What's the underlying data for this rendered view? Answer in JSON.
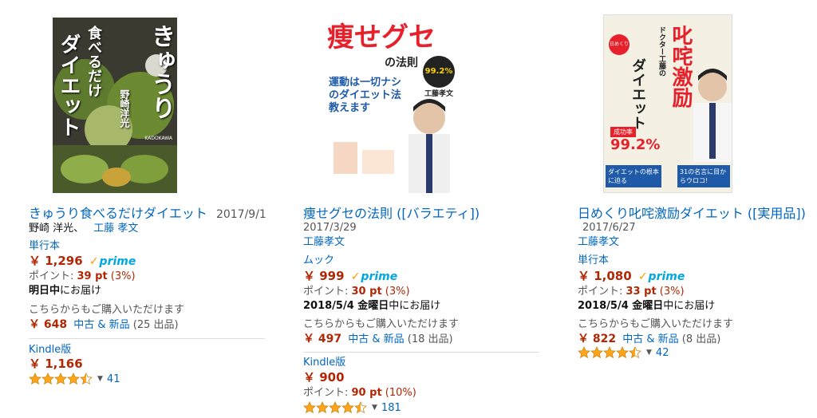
{
  "products": [
    {
      "cover": {
        "title_big": "きゅうり",
        "title_sub": "食べるだけ",
        "title_main": "ダイエット",
        "authors_vertical": "野崎洋光",
        "publisher": "KADOKAWA",
        "colors": {
          "bg": "#2b2a26",
          "accent": "#ffffff"
        }
      },
      "title": "きゅうり食べるだけダイエット",
      "date": "2017/9/1",
      "author1": "野崎 洋光、",
      "author2": "工藤 孝文",
      "format1": "単行本",
      "price1": "￥ 1,296",
      "prime": "prime",
      "points_label": "ポイント: ",
      "points_value": "39 pt",
      "points_pct": " (3%)",
      "delivery_bold": "明日中",
      "delivery_rest": "にお届け",
      "other_buy": "こちらからもご購入いただけます",
      "used_price": "￥ 648",
      "used_link": "中古 & 新品",
      "used_count": " (25 出品)",
      "format2": "Kindle版",
      "price2": "￥ 1,166",
      "rating": 4.5,
      "review_count": "41"
    },
    {
      "cover": {
        "title_big": "痩せグセ",
        "title_suffix": "の法則",
        "tagline": "運動は一切ナシのダイエット法教えます",
        "badge": "99.2%",
        "author": "工藤孝文",
        "colors": {
          "bg": "#ffffff",
          "accent": "#e6212b",
          "text": "#1e5aa8"
        }
      },
      "title": "痩せグセの法則 ([バラエティ])",
      "date": "2017/3/29",
      "author1": "工藤孝文",
      "format1": "ムック",
      "price1": "￥ 999",
      "prime": "prime",
      "points_label": "ポイント: ",
      "points_value": "30 pt",
      "points_pct": " (3%)",
      "delivery_bold": "2018/5/4 金曜日",
      "delivery_rest": "中にお届け",
      "other_buy": "こちらからもご購入いただけます",
      "used_price": "￥ 497",
      "used_link": "中古 & 新品",
      "used_count": " (18 出品)",
      "format2": "Kindle版",
      "price2": "￥ 900",
      "points2_label": "ポイント: ",
      "points2_value": "90 pt",
      "points2_pct": " (10%)",
      "rating": 4.5,
      "review_count": "181"
    },
    {
      "cover": {
        "badge_top": "日めくり",
        "title_big": "叱咤激励",
        "title_main": "ダイエット",
        "side_text": "ドクター工藤の",
        "rate_label": "成功率",
        "rate_value": "99.2%",
        "bottom_left": "ダイエットの根本に迫る",
        "bottom_right": "31の名言に目からウロコ!",
        "colors": {
          "bg": "#f4f1e4",
          "accent": "#e6212b",
          "banner": "#1e5aa8"
        }
      },
      "title": "日めくり叱咤激励ダイエット ([実用品])",
      "date": "2017/6/27",
      "author1": "工藤孝文",
      "format1": "単行本",
      "price1": "￥ 1,080",
      "prime": "prime",
      "points_label": "ポイント: ",
      "points_value": "33 pt",
      "points_pct": " (3%)",
      "delivery_bold": "2018/5/4 金曜日",
      "delivery_rest": "中にお届け",
      "other_buy": "こちらからもご購入いただけます",
      "used_price": "￥ 822",
      "used_link": "中古 & 新品",
      "used_count": " (8 出品)",
      "rating": 4.5,
      "review_count": "42"
    }
  ],
  "colors": {
    "link": "#0066c0",
    "price": "#b12704",
    "star": "#ffa41c"
  }
}
